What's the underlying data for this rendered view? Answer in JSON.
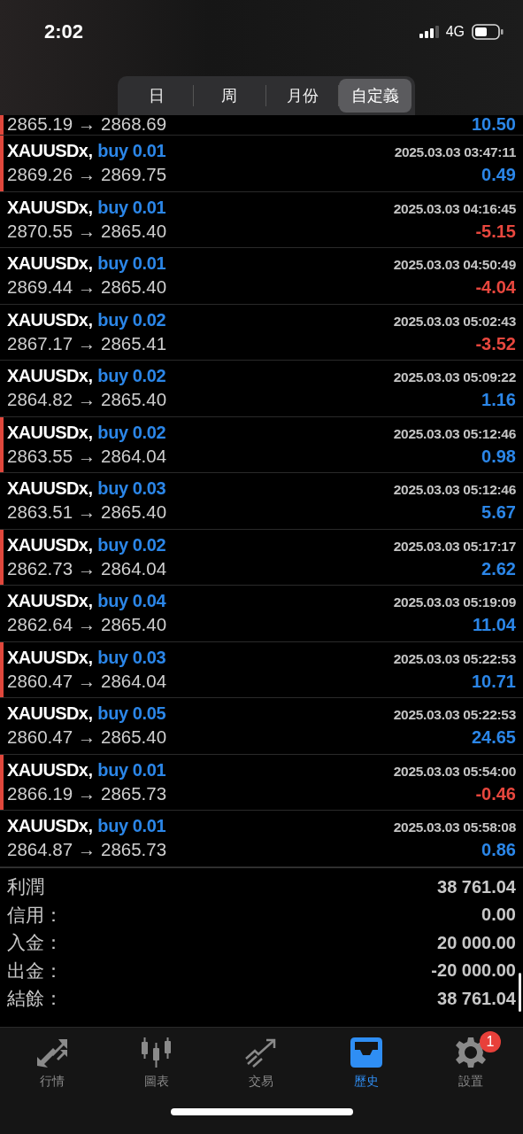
{
  "status_bar": {
    "time": "2:02",
    "network": "4G"
  },
  "period_tabs": [
    {
      "label": "日",
      "selected": false
    },
    {
      "label": "周",
      "selected": false
    },
    {
      "label": "月份",
      "selected": false
    },
    {
      "label": "自定義",
      "selected": true
    }
  ],
  "partial_row": {
    "prices": "2865.19 → 2868.69",
    "profit": "10.50",
    "profit_positive": true,
    "marked": true
  },
  "deals": [
    {
      "symbol": "XAUUSDx,",
      "order": "buy 0.01",
      "time": "2025.03.03 03:47:11",
      "prices": "2869.26 → 2869.75",
      "profit": "0.49",
      "profit_positive": true,
      "marked": true
    },
    {
      "symbol": "XAUUSDx,",
      "order": "buy 0.01",
      "time": "2025.03.03 04:16:45",
      "prices": "2870.55 → 2865.40",
      "profit": "-5.15",
      "profit_positive": false,
      "marked": false
    },
    {
      "symbol": "XAUUSDx,",
      "order": "buy 0.01",
      "time": "2025.03.03 04:50:49",
      "prices": "2869.44 → 2865.40",
      "profit": "-4.04",
      "profit_positive": false,
      "marked": false
    },
    {
      "symbol": "XAUUSDx,",
      "order": "buy 0.02",
      "time": "2025.03.03 05:02:43",
      "prices": "2867.17 → 2865.41",
      "profit": "-3.52",
      "profit_positive": false,
      "marked": false
    },
    {
      "symbol": "XAUUSDx,",
      "order": "buy 0.02",
      "time": "2025.03.03 05:09:22",
      "prices": "2864.82 → 2865.40",
      "profit": "1.16",
      "profit_positive": true,
      "marked": false
    },
    {
      "symbol": "XAUUSDx,",
      "order": "buy 0.02",
      "time": "2025.03.03 05:12:46",
      "prices": "2863.55 → 2864.04",
      "profit": "0.98",
      "profit_positive": true,
      "marked": true
    },
    {
      "symbol": "XAUUSDx,",
      "order": "buy 0.03",
      "time": "2025.03.03 05:12:46",
      "prices": "2863.51 → 2865.40",
      "profit": "5.67",
      "profit_positive": true,
      "marked": false
    },
    {
      "symbol": "XAUUSDx,",
      "order": "buy 0.02",
      "time": "2025.03.03 05:17:17",
      "prices": "2862.73 → 2864.04",
      "profit": "2.62",
      "profit_positive": true,
      "marked": true
    },
    {
      "symbol": "XAUUSDx,",
      "order": "buy 0.04",
      "time": "2025.03.03 05:19:09",
      "prices": "2862.64 → 2865.40",
      "profit": "11.04",
      "profit_positive": true,
      "marked": false
    },
    {
      "symbol": "XAUUSDx,",
      "order": "buy 0.03",
      "time": "2025.03.03 05:22:53",
      "prices": "2860.47 → 2864.04",
      "profit": "10.71",
      "profit_positive": true,
      "marked": true
    },
    {
      "symbol": "XAUUSDx,",
      "order": "buy 0.05",
      "time": "2025.03.03 05:22:53",
      "prices": "2860.47 → 2865.40",
      "profit": "24.65",
      "profit_positive": true,
      "marked": false
    },
    {
      "symbol": "XAUUSDx,",
      "order": "buy 0.01",
      "time": "2025.03.03 05:54:00",
      "prices": "2866.19 → 2865.73",
      "profit": "-0.46",
      "profit_positive": false,
      "marked": true
    },
    {
      "symbol": "XAUUSDx,",
      "order": "buy 0.01",
      "time": "2025.03.03 05:58:08",
      "prices": "2864.87 → 2865.73",
      "profit": "0.86",
      "profit_positive": true,
      "marked": false
    }
  ],
  "summary": [
    {
      "label": "利潤",
      "value": "38 761.04"
    },
    {
      "label": "信用：",
      "value": "0.00"
    },
    {
      "label": "入金：",
      "value": "20 000.00"
    },
    {
      "label": "出金：",
      "value": "-20 000.00"
    },
    {
      "label": "結餘：",
      "value": "38 761.04"
    }
  ],
  "tab_bar": [
    {
      "kind": "quotes",
      "label": "行情",
      "selected": false
    },
    {
      "kind": "chart",
      "label": "圖表",
      "selected": false
    },
    {
      "kind": "trade",
      "label": "交易",
      "selected": false
    },
    {
      "kind": "history",
      "label": "歷史",
      "selected": true
    },
    {
      "kind": "settings",
      "label": "設置",
      "selected": false,
      "badge": "1"
    }
  ]
}
